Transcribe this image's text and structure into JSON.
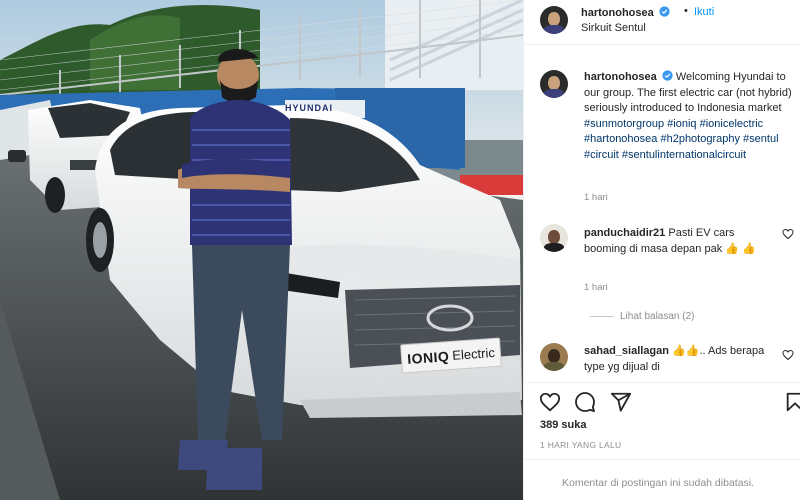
{
  "post": {
    "username": "hartonohosea",
    "separator": "•",
    "follow_label": "Ikuti",
    "location": "Sirkuit Sentul",
    "caption_username": "hartonohosea",
    "caption_text": "Welcoming Hyundai to our group. The first electric car (not hybrid) seriously introduced to Indonesia market",
    "hashtags": [
      "#sunmotorgroup",
      "#ioniq",
      "#ionicelectric",
      "#hartonohosea",
      "#h2photography",
      "#sentul",
      "#circuit",
      "#sentulinternationalcircuit"
    ],
    "caption_time": "1 hari"
  },
  "photo": {
    "plate_brand": "IONIQ",
    "plate_model": "Electric",
    "banner_text": "HYUNDAI"
  },
  "comments": [
    {
      "username": "panduchaidir21",
      "text": "Pasti EV cars booming di masa depan pak 👍 👍",
      "time": "1 hari",
      "replies_label": "Lihat balasan (2)"
    },
    {
      "username": "sahad_siallagan",
      "text": "👍👍.. Ads berapa type yg dijual di"
    }
  ],
  "engagement": {
    "likes": "389 suka",
    "date": "1 HARI YANG LALU",
    "comments_disabled": "Komentar di postingan ini sudah dibatasi."
  },
  "icons": {
    "verified": "verified-badge-icon",
    "like": "heart-icon",
    "comment": "comment-bubble-icon",
    "share": "paper-plane-icon",
    "save": "bookmark-icon"
  },
  "colors": {
    "link_blue": "#0095f6",
    "hashtag_blue": "#00376b",
    "muted_gray": "#8e8e8e",
    "text": "#262626",
    "verified_blue": "#3897f0"
  }
}
